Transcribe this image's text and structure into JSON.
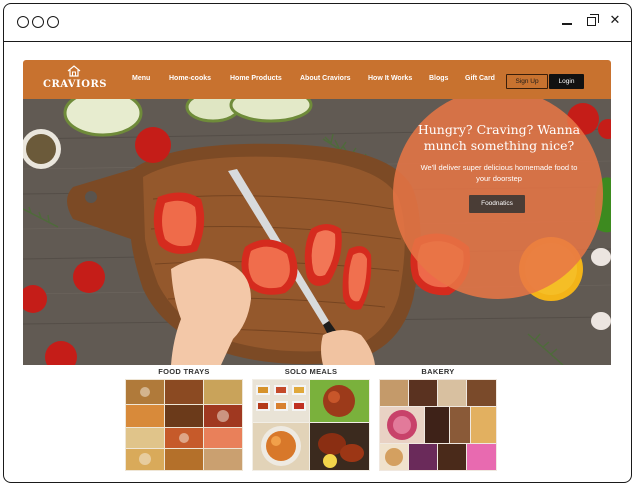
{
  "window": {
    "controls": [
      "minimize-icon",
      "maximize-icon",
      "close-icon"
    ]
  },
  "brand": {
    "name": "CRAVIORS",
    "color": "#c8722f"
  },
  "nav": {
    "items": [
      "Menu",
      "Home-cooks",
      "Home Products",
      "About Craviors",
      "How It Works",
      "Blogs",
      "Gift Card"
    ],
    "signup": "Sign Up",
    "login": "Login"
  },
  "hero": {
    "headline": "Hungry? Craving? Wanna munch something nice?",
    "subtext": "We'll deliver super delicious homemade food to your doorstep",
    "cta": "Foodnatics",
    "overlay_color": "#e87646"
  },
  "categories": [
    {
      "title": "FOOD TRAYS"
    },
    {
      "title": "SOLO MEALS"
    },
    {
      "title": "BAKERY"
    }
  ]
}
